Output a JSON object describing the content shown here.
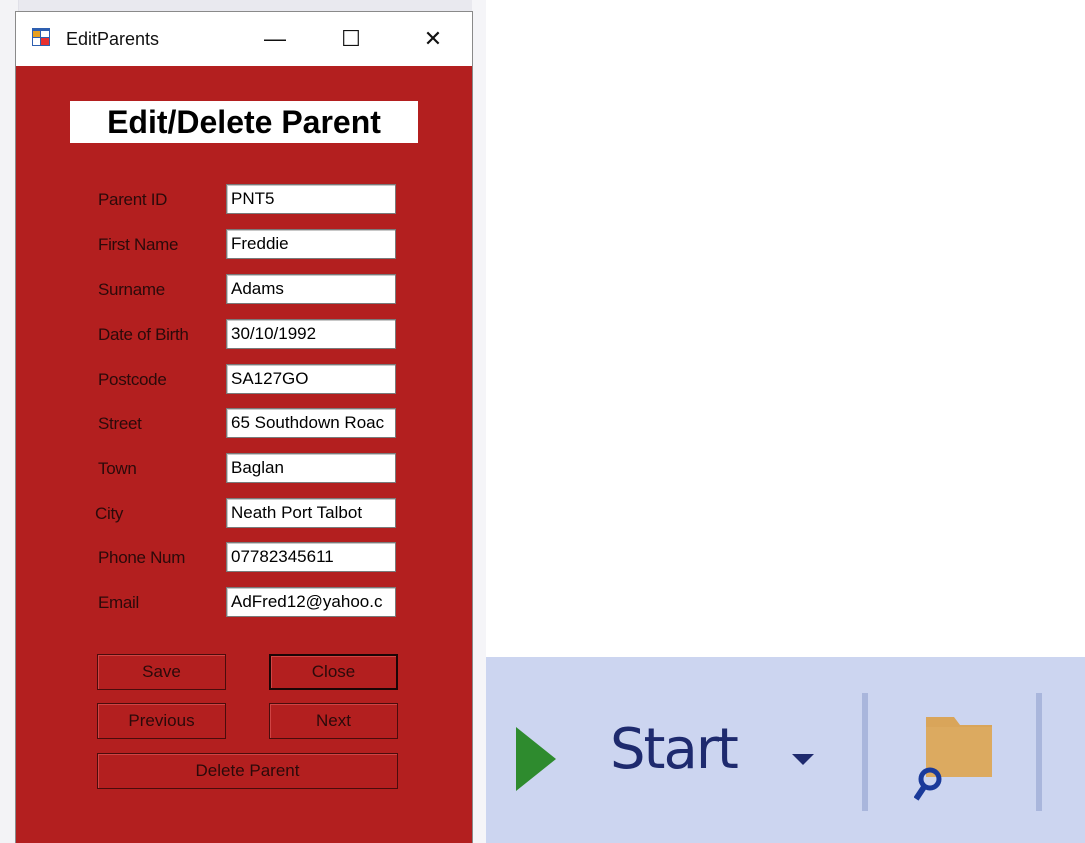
{
  "window": {
    "title": "EditParents",
    "controls": {
      "minimize": "—",
      "maximize": "☐",
      "close": "✕"
    }
  },
  "form": {
    "heading": "Edit/Delete Parent",
    "fields": [
      {
        "label": "Parent ID",
        "value": "PNT5"
      },
      {
        "label": "First Name",
        "value": "Freddie"
      },
      {
        "label": "Surname",
        "value": "Adams"
      },
      {
        "label": "Date of Birth",
        "value": "30/10/1992"
      },
      {
        "label": "Postcode",
        "value": "SA127GO"
      },
      {
        "label": "Street",
        "value": "65 Southdown Roac"
      },
      {
        "label": "Town",
        "value": "Baglan"
      },
      {
        "label": "City",
        "value": "Neath Port Talbot"
      },
      {
        "label": "Phone Num",
        "value": "07782345611"
      },
      {
        "label": "Email",
        "value": "AdFred12@yahoo.c"
      }
    ],
    "buttons": {
      "save": "Save",
      "close": "Close",
      "previous": "Previous",
      "next": "Next",
      "delete": "Delete Parent"
    }
  },
  "toolbar": {
    "start_label": "Start"
  },
  "colors": {
    "form_background": "#b31f1f",
    "toolbar_background": "#ccd5f0",
    "play_icon": "#2e8b2e"
  }
}
